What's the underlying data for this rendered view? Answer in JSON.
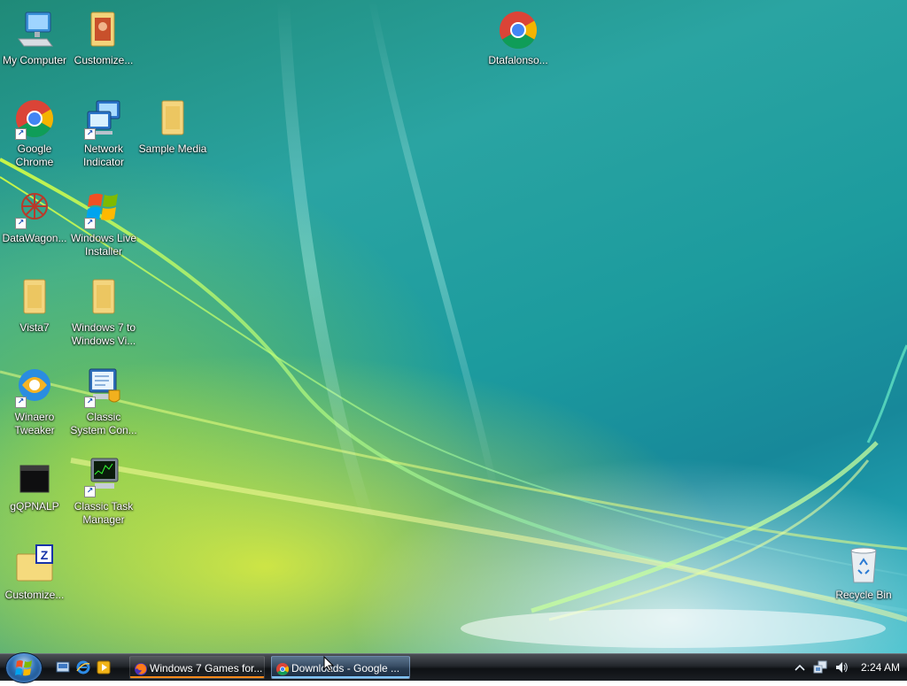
{
  "desktop": {
    "icons": [
      {
        "id": "my-computer",
        "label": "My Computer",
        "icon": "computer-icon"
      },
      {
        "id": "customize-1",
        "label": "Customize...",
        "icon": "folder-icon"
      },
      {
        "id": "dtafalonso",
        "label": "Dtafalonso...",
        "icon": "chrome-icon"
      },
      {
        "id": "google-chrome",
        "label": "Google Chrome",
        "icon": "chrome-icon"
      },
      {
        "id": "network-indicator",
        "label": "Network Indicator",
        "icon": "network-icon"
      },
      {
        "id": "sample-media",
        "label": "Sample Media",
        "icon": "folder-icon"
      },
      {
        "id": "datawagon",
        "label": "DataWagon...",
        "icon": "datawagon-icon"
      },
      {
        "id": "windows-live-installer",
        "label": "Windows Live Installer",
        "icon": "windows-flag-icon"
      },
      {
        "id": "vista7",
        "label": "Vista7",
        "icon": "folder-icon"
      },
      {
        "id": "win7-to-vista",
        "label": "Windows 7 to Windows Vi...",
        "icon": "folder-icon"
      },
      {
        "id": "winaero-tweaker",
        "label": "Winaero Tweaker",
        "icon": "winaero-icon"
      },
      {
        "id": "classic-system-con",
        "label": "Classic System Con...",
        "icon": "system-config-icon"
      },
      {
        "id": "gqpnalp",
        "label": "gQPNALP",
        "icon": "black-square-icon"
      },
      {
        "id": "classic-task-manager",
        "label": "Classic Task Manager",
        "icon": "task-manager-icon"
      },
      {
        "id": "customize-2",
        "label": "Customize...",
        "icon": "zip-folder-icon"
      },
      {
        "id": "recycle-bin",
        "label": "Recycle Bin",
        "icon": "recycle-bin-icon"
      }
    ]
  },
  "taskbar": {
    "start_button": "start-orb-icon",
    "quick_launch": [
      "show-desktop-icon",
      "internet-explorer-icon",
      "media-player-icon"
    ],
    "buttons": [
      {
        "label": "Windows 7 Games for...",
        "icon": "firefox-icon",
        "state": "inactive"
      },
      {
        "label": "Downloads - Google ...",
        "icon": "chrome-icon",
        "state": "active"
      }
    ],
    "tray": [
      "show-hidden-icons-chevron",
      "network-icon",
      "volume-icon"
    ],
    "clock": "2:24 AM"
  },
  "colors": {
    "taskbar": "#1b1f24",
    "label_text": "#ffffff",
    "active_underline": "#7ec4ff",
    "firefox_underline": "#ff8a1a"
  }
}
